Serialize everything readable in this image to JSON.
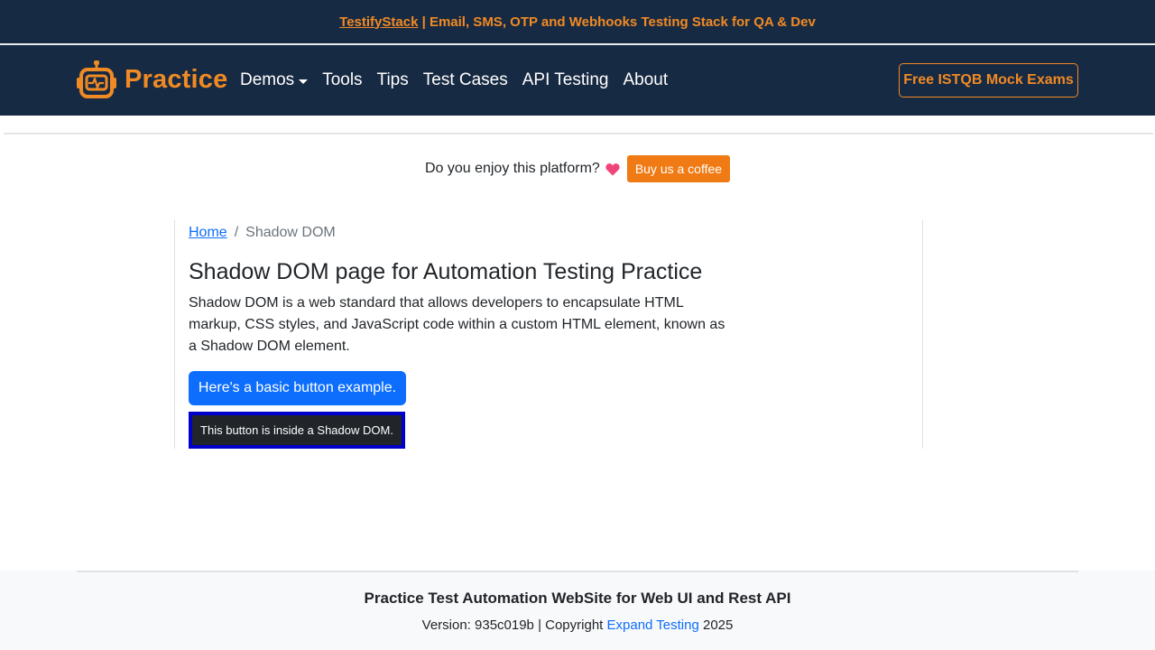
{
  "banner": {
    "link_text": "TestifyStack",
    "tagline": " | Email, SMS, OTP and Webhooks Testing Stack for QA & Dev"
  },
  "navbar": {
    "brand": "Practice",
    "brand_icon": "robot-icon",
    "links": [
      "Demos",
      "Tools",
      "Tips",
      "Test Cases",
      "API Testing",
      "About"
    ],
    "cta": "Free ISTQB Mock Exams"
  },
  "coffee": {
    "prompt": "Do you enjoy this platform?",
    "icon": "heart-icon",
    "button": "Buy us a coffee"
  },
  "breadcrumb": {
    "home": "Home",
    "separator": "/",
    "current": "Shadow DOM"
  },
  "main": {
    "title": "Shadow DOM page for Automation Testing Practice",
    "description": "Shadow DOM is a web standard that allows developers to encapsulate HTML markup, CSS styles, and JavaScript code within a custom HTML element, known as a Shadow DOM element.",
    "basic_button": "Here's a basic button example.",
    "shadow_button": "This button is inside a Shadow DOM."
  },
  "footer": {
    "title": "Practice Test Automation WebSite for Web UI and Rest API",
    "version_prefix": "Version: 935c019b | Copyright ",
    "company": "Expand Testing",
    "year": " 2025"
  },
  "colors": {
    "navy": "#172a43",
    "orange": "#f08a24",
    "primary": "#0d6efd"
  }
}
